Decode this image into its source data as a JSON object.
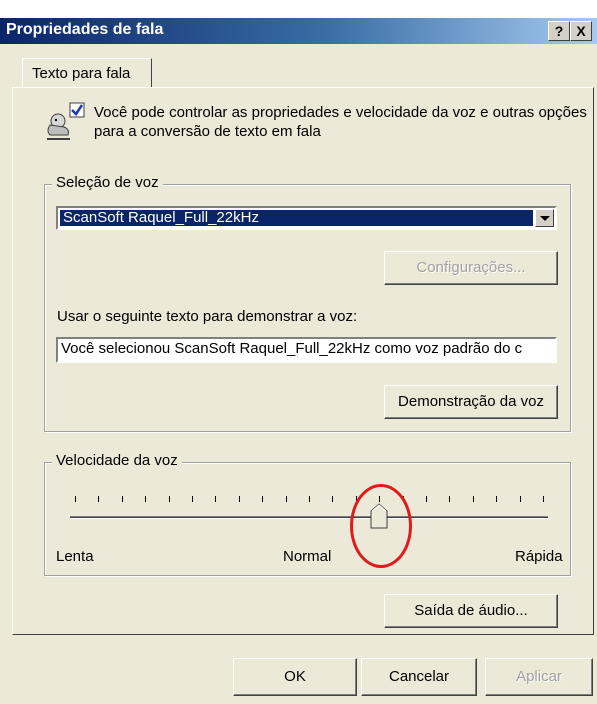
{
  "window": {
    "title": "Propriedades de fala",
    "help_button": "?",
    "close_button": "X"
  },
  "tabs": [
    {
      "label": "Texto para fala"
    }
  ],
  "intro": {
    "text": "Você pode controlar as propriedades e velocidade da voz e outras opções para a conversão de texto em fala",
    "icon": "speech-person-icon"
  },
  "voice_selection": {
    "group_label": "Seleção de voz",
    "selected_voice": "ScanSoft Raquel_Full_22kHz",
    "settings_button": "Configurações...",
    "demo_label": "Usar o seguinte texto para demonstrar a voz:",
    "demo_text": "Você selecionou ScanSoft Raquel_Full_22kHz como voz padrão do c",
    "demo_button": "Demonstração da voz"
  },
  "voice_speed": {
    "group_label": "Velocidade da voz",
    "label_slow": "Lenta",
    "label_normal": "Normal",
    "label_fast": "Rápida",
    "tick_count": 21,
    "position_fraction": 0.65
  },
  "audio_output_button": "Saída de áudio...",
  "footer": {
    "ok": "OK",
    "cancel": "Cancelar",
    "apply": "Aplicar"
  },
  "colors": {
    "titlebar": "#0a246a",
    "dialog_bg": "#ece9d8",
    "selection": "#0a246a",
    "annotation_circle": "#e01b1b"
  }
}
